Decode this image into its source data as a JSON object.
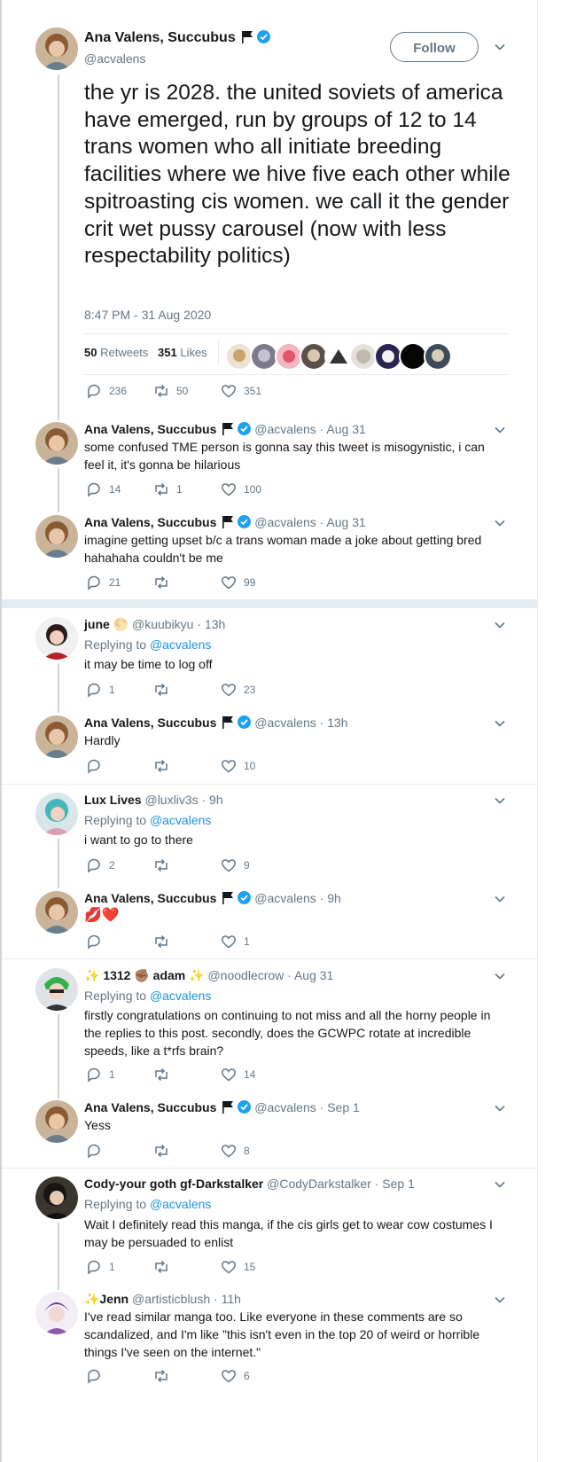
{
  "main_tweet": {
    "display_name": "Ana Valens, Succubus",
    "handle": "@acvalens",
    "follow_label": "Follow",
    "text": "the yr is 2028. the united soviets of america have emerged, run by groups of 12 to 14 trans women who all initiate breeding facilities where we hive five each other while spitroasting cis women. we call it the gender crit wet pussy carousel (now with less respectability politics)",
    "timestamp": "8:47 PM - 31 Aug 2020",
    "retweets_count": "50",
    "retweets_label": "Retweets",
    "likes_count": "351",
    "likes_label": "Likes",
    "reply_count": "236",
    "retweet_count": "50",
    "like_count": "351"
  },
  "replies": [
    {
      "name": "Ana Valens, Succubus",
      "handle": "@acvalens",
      "time": "· Aug 31",
      "replying": "",
      "text": "some confused TME person is gonna say this tweet is misogynistic, i can feel it, it's gonna be hilarious",
      "replies": "14",
      "retweets": "1",
      "likes": "100"
    },
    {
      "name": "Ana Valens, Succubus",
      "handle": "@acvalens",
      "time": "· Aug 31",
      "replying": "",
      "text": "imagine getting upset b/c a trans woman made a joke about getting bred hahahaha couldn't be me",
      "replies": "21",
      "retweets": "",
      "likes": "99"
    },
    {
      "name": "june",
      "handle": "@kuubikyu",
      "time": "· 13h",
      "replying_prefix": "Replying to",
      "replying_handle": "@acvalens",
      "text": "it may be time to log off",
      "replies": "1",
      "retweets": "",
      "likes": "23"
    },
    {
      "name": "Ana Valens, Succubus",
      "handle": "@acvalens",
      "time": "· 13h",
      "text": "Hardly",
      "replies": "",
      "retweets": "",
      "likes": "10"
    },
    {
      "name": "Lux Lives",
      "handle": "@luxliv3s",
      "time": "· 9h",
      "replying_prefix": "Replying to",
      "replying_handle": "@acvalens",
      "text": "i want to go to there",
      "replies": "2",
      "retweets": "",
      "likes": "9"
    },
    {
      "name": "Ana Valens, Succubus",
      "handle": "@acvalens",
      "time": "· 9h",
      "text": "💋❤️",
      "replies": "",
      "retweets": "",
      "likes": "1"
    },
    {
      "name_pre": "✨ 1312",
      "name_mid": "✊🏽 adam ✨",
      "handle": "@noodlecrow",
      "time": "· Aug 31",
      "replying_prefix": "Replying to",
      "replying_handle": "@acvalens",
      "text": "firstly congratulations on continuing to not miss and all the horny people in the replies to this post. secondly, does the GCWPC rotate at incredible speeds, like a t*rfs brain?",
      "replies": "1",
      "retweets": "",
      "likes": "14"
    },
    {
      "name": "Ana Valens, Succubus",
      "handle": "@acvalens",
      "time": "· Sep 1",
      "text": "Yess",
      "replies": "",
      "retweets": "",
      "likes": "8"
    },
    {
      "name": "Cody-your goth gf-Darkstalker",
      "handle": "@CodyDarkstalker",
      "time": "· Sep 1",
      "replying_prefix": "Replying to",
      "replying_handle": "@acvalens",
      "text": "Wait I definitely read this manga, if the cis girls get to wear cow costumes I may be persuaded to enlist",
      "replies": "1",
      "retweets": "",
      "likes": "15"
    },
    {
      "name": "✨Jenn",
      "handle": "@artisticblush",
      "time": "· 11h",
      "text": "I've read similar manga too. Like everyone in these comments are so scandalized, and I'm like \"this isn't even in the top 20 of weird or horrible things I've seen on the internet.\"",
      "replies": "",
      "retweets": "",
      "likes": "6"
    }
  ],
  "icons": {
    "reply": "reply-icon",
    "retweet": "retweet-icon",
    "like": "heart-icon",
    "more": "chevron-down-icon",
    "verified": "verified-badge-icon",
    "flag": "black-flag-icon"
  },
  "colors": {
    "link": "#1b95e0",
    "muted": "#657786",
    "verified": "#1da1f2",
    "divider": "#e6ecf0"
  }
}
